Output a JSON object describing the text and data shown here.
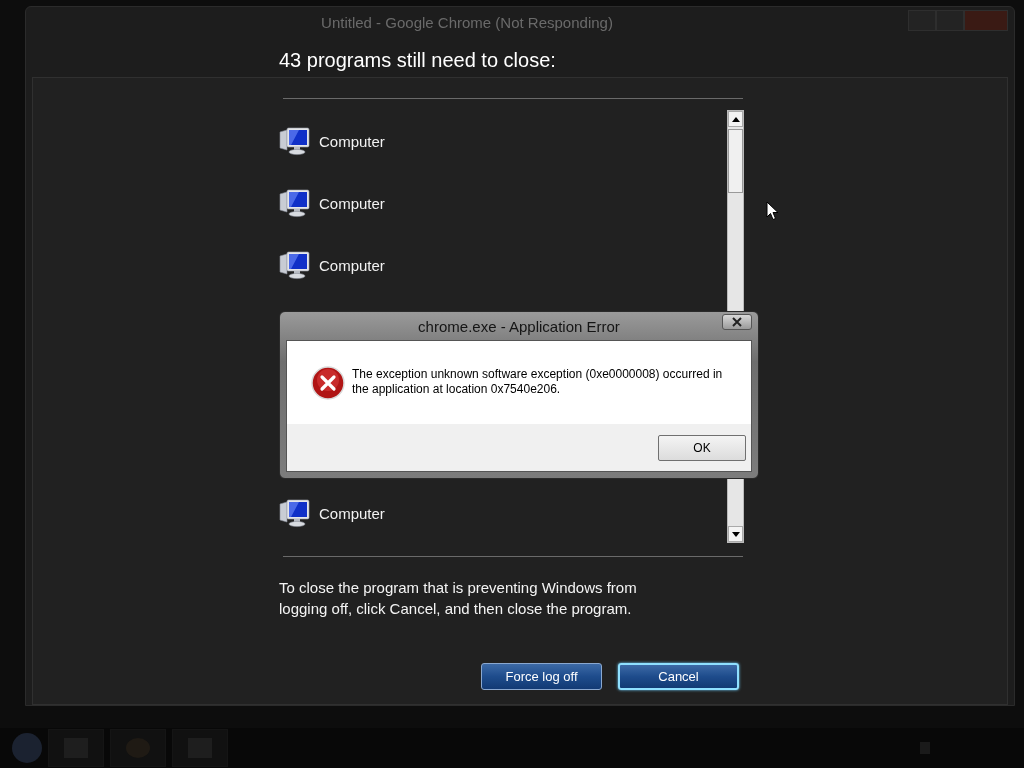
{
  "background_window": {
    "title": "Untitled - Google Chrome (Not Responding)"
  },
  "logoff": {
    "heading": "43 programs still need to close:",
    "programs": [
      {
        "name": "Computer"
      },
      {
        "name": "Computer"
      },
      {
        "name": "Computer"
      },
      {
        "name": "Computer"
      }
    ],
    "message": "To close the program that is preventing Windows from logging off, click Cancel, and then close the program.",
    "buttons": [
      {
        "label": "Force log off",
        "focused": false
      },
      {
        "label": "Cancel",
        "focused": true
      }
    ]
  },
  "error_dialog": {
    "title": "chrome.exe - Application Error",
    "message": "The exception unknown software exception (0xe0000008) occurred in the application at location 0x7540e206.",
    "buttons": [
      "OK"
    ]
  }
}
